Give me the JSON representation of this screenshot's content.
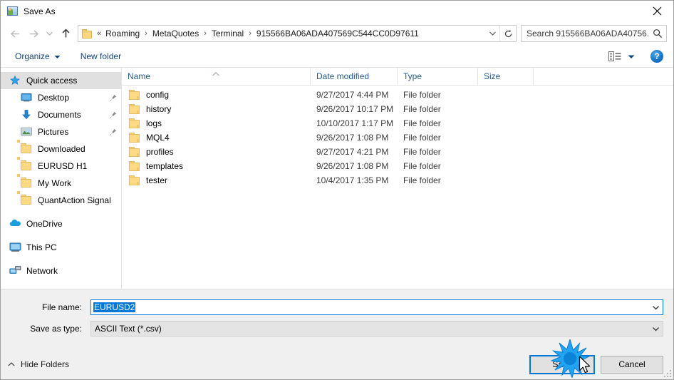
{
  "window": {
    "title": "Save As",
    "icon": "save-as-app-icon",
    "close_label": "✕"
  },
  "nav": {
    "back_label": "Back",
    "forward_label": "Forward",
    "recent_label": "Recent locations",
    "up_label": "Up",
    "address": {
      "overflow": "«",
      "crumbs": [
        "Roaming",
        "MetaQuotes",
        "Terminal",
        "915566BA06ADA407569C544CC0D97611"
      ],
      "separator": "›",
      "dropdown_label": "Previous locations",
      "refresh_label": "Refresh"
    },
    "search": {
      "placeholder": "Search 915566BA06ADA40756...",
      "value": "",
      "icon": "search-icon"
    }
  },
  "toolbar": {
    "organize_label": "Organize",
    "new_folder_label": "New folder",
    "view_label": "Change your view",
    "help_label": "?"
  },
  "sidebar": {
    "items": [
      {
        "label": "Quick access",
        "icon": "star-icon",
        "selected": true,
        "level": "root",
        "pinned": false
      },
      {
        "label": "Desktop",
        "icon": "desktop-icon",
        "selected": false,
        "level": "child",
        "pinned": true
      },
      {
        "label": "Documents",
        "icon": "documents-icon",
        "selected": false,
        "level": "child",
        "pinned": true
      },
      {
        "label": "Pictures",
        "icon": "pictures-icon",
        "selected": false,
        "level": "child",
        "pinned": true
      },
      {
        "label": "Downloaded",
        "icon": "folder-icon",
        "selected": false,
        "level": "child",
        "pinned": false
      },
      {
        "label": "EURUSD H1",
        "icon": "folder-icon",
        "selected": false,
        "level": "child",
        "pinned": false
      },
      {
        "label": "My Work",
        "icon": "folder-icon",
        "selected": false,
        "level": "child",
        "pinned": false
      },
      {
        "label": "QuantAction Signal",
        "icon": "folder-icon",
        "selected": false,
        "level": "child",
        "pinned": false
      },
      {
        "label": "OneDrive",
        "icon": "onedrive-icon",
        "selected": false,
        "level": "root",
        "pinned": false,
        "gap_before": true
      },
      {
        "label": "This PC",
        "icon": "this-pc-icon",
        "selected": false,
        "level": "root",
        "pinned": false,
        "gap_before": true
      },
      {
        "label": "Network",
        "icon": "network-icon",
        "selected": false,
        "level": "root",
        "pinned": false,
        "gap_before": true
      }
    ]
  },
  "filelist": {
    "columns": [
      "Name",
      "Date modified",
      "Type",
      "Size"
    ],
    "sorted_by": "Name",
    "sort_direction": "ascending",
    "rows": [
      {
        "name": "config",
        "date": "9/27/2017 4:44 PM",
        "type": "File folder",
        "size": ""
      },
      {
        "name": "history",
        "date": "9/26/2017 10:17 PM",
        "type": "File folder",
        "size": ""
      },
      {
        "name": "logs",
        "date": "10/10/2017 1:17 PM",
        "type": "File folder",
        "size": ""
      },
      {
        "name": "MQL4",
        "date": "9/26/2017 1:08 PM",
        "type": "File folder",
        "size": ""
      },
      {
        "name": "profiles",
        "date": "9/27/2017 4:21 PM",
        "type": "File folder",
        "size": ""
      },
      {
        "name": "templates",
        "date": "9/26/2017 1:08 PM",
        "type": "File folder",
        "size": ""
      },
      {
        "name": "tester",
        "date": "10/4/2017 1:35 PM",
        "type": "File folder",
        "size": ""
      }
    ]
  },
  "form": {
    "filename_label": "File name:",
    "filename_value": "EURUSD2",
    "filename_selected": true,
    "filetype_label": "Save as type:",
    "filetype_value": "ASCII Text (*.csv)"
  },
  "footer": {
    "hide_folders_label": "Hide Folders",
    "save_label": "Save",
    "cancel_label": "Cancel"
  },
  "colors": {
    "accent": "#0078d7",
    "folder": "#fcd983",
    "link": "#12457a",
    "header_text": "#2b5c8a",
    "form_bg": "#f0f0f0"
  }
}
